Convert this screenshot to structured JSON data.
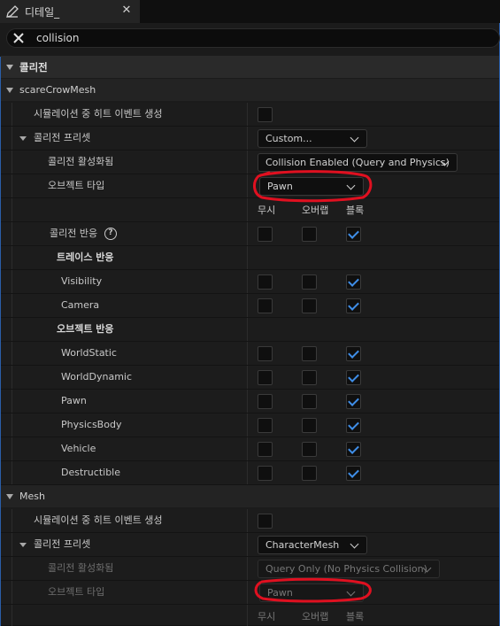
{
  "tab": {
    "title": "디테일_",
    "close": "✕"
  },
  "search": {
    "value": "collision"
  },
  "category": {
    "label": "콜리전"
  },
  "scareCrowMesh": {
    "header": "scareCrowMesh",
    "sim_hit_label": "시뮬레이션 중 히트 이벤트 생성",
    "preset_label": "콜리전 프리셋",
    "preset_value": "Custom...",
    "enabled_label": "콜리전 활성화됨",
    "enabled_value": "Collision Enabled (Query and Physics)",
    "object_type_label": "오브젝트 타입",
    "object_type_value": "Pawn",
    "col_ignore": "무시",
    "col_overlap": "오버랩",
    "col_block": "블록",
    "response_label": "콜리전 반응",
    "trace_label": "트레이스 반응",
    "object_resp_label": "오브젝트 반응",
    "channels": [
      {
        "name": "Visibility",
        "response": "block"
      },
      {
        "name": "Camera",
        "response": "block"
      },
      {
        "name": "WorldStatic",
        "response": "block"
      },
      {
        "name": "WorldDynamic",
        "response": "block"
      },
      {
        "name": "Pawn",
        "response": "block"
      },
      {
        "name": "PhysicsBody",
        "response": "block"
      },
      {
        "name": "Vehicle",
        "response": "block"
      },
      {
        "name": "Destructible",
        "response": "block"
      }
    ]
  },
  "mesh": {
    "header": "Mesh",
    "sim_hit_label": "시뮬레이션 중 히트 이벤트 생성",
    "preset_label": "콜리전 프리셋",
    "preset_value": "CharacterMesh",
    "enabled_label": "콜리전 활성화됨",
    "enabled_value": "Query Only (No Physics Collision)",
    "object_type_label": "오브젝트 타입",
    "object_type_value": "Pawn",
    "col_ignore": "무시",
    "col_overlap": "오버랩",
    "col_block": "블록"
  },
  "colors": {
    "accent": "#3f8ee8",
    "annotation": "#e01020",
    "panel_border": "#2a5ea8"
  }
}
